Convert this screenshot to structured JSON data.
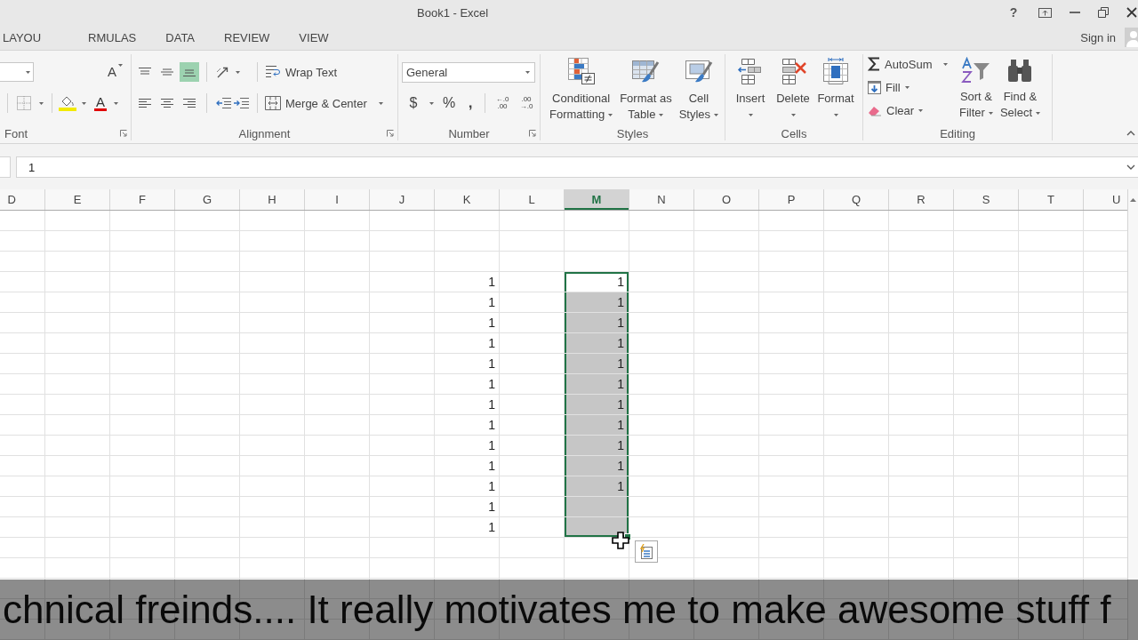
{
  "window": {
    "title": "Book1 - Excel",
    "help": "?",
    "sign_in": "Sign in"
  },
  "tabs": [
    {
      "label": "LAYOU",
      "selected": false
    },
    {
      "label": "RMULAS",
      "selected": false
    },
    {
      "label": "DATA",
      "selected": false
    },
    {
      "label": "REVIEW",
      "selected": false
    },
    {
      "label": "VIEW",
      "selected": false
    }
  ],
  "ribbon": {
    "font": {
      "label": "Font",
      "grow_font": "A",
      "font_color": "A"
    },
    "alignment": {
      "label": "Alignment",
      "vertical": [
        {
          "kind": "top",
          "selected": false
        },
        {
          "kind": "middle",
          "selected": false
        },
        {
          "kind": "bottom",
          "selected": true
        }
      ],
      "horizontal": [
        {
          "kind": "left",
          "selected": false
        },
        {
          "kind": "center",
          "selected": false
        },
        {
          "kind": "right",
          "selected": false
        }
      ],
      "wrap_text": "Wrap Text",
      "merge_center": "Merge & Center"
    },
    "number": {
      "label": "Number",
      "format": "General",
      "currency": "$",
      "percent": "%",
      "comma": ",",
      "decrease_decimal": [
        "←.0",
        ".00"
      ],
      "increase_decimal": [
        ".00",
        "→.0"
      ]
    },
    "styles": {
      "label": "Styles",
      "buttons": [
        {
          "kind": "conditional",
          "lines": [
            "Conditional",
            "Formatting"
          ]
        },
        {
          "kind": "table",
          "lines": [
            "Format as",
            "Table"
          ]
        },
        {
          "kind": "cell",
          "lines": [
            "Cell",
            "Styles"
          ]
        }
      ]
    },
    "cells": {
      "label": "Cells",
      "buttons": [
        {
          "kind": "insert",
          "label": "Insert"
        },
        {
          "kind": "delete",
          "label": "Delete"
        },
        {
          "kind": "format",
          "label": "Format"
        }
      ]
    },
    "editing": {
      "label": "Editing",
      "small": [
        {
          "kind": "autosum",
          "label": "AutoSum"
        },
        {
          "kind": "fill",
          "label": "Fill"
        },
        {
          "kind": "clear",
          "label": "Clear"
        }
      ],
      "big": [
        {
          "kind": "sort",
          "lines": [
            "Sort &",
            "Filter"
          ]
        },
        {
          "kind": "find",
          "lines": [
            "Find &",
            "Select"
          ]
        }
      ]
    }
  },
  "formula_bar": {
    "value": "1"
  },
  "sheet": {
    "columns": [
      {
        "label": "D",
        "selected": false
      },
      {
        "label": "E",
        "selected": false
      },
      {
        "label": "F",
        "selected": false
      },
      {
        "label": "G",
        "selected": false
      },
      {
        "label": "H",
        "selected": false
      },
      {
        "label": "I",
        "selected": false
      },
      {
        "label": "J",
        "selected": false
      },
      {
        "label": "K",
        "selected": false
      },
      {
        "label": "L",
        "selected": false
      },
      {
        "label": "M",
        "selected": true
      },
      {
        "label": "N",
        "selected": false
      },
      {
        "label": "O",
        "selected": false
      },
      {
        "label": "P",
        "selected": false
      },
      {
        "label": "Q",
        "selected": false
      },
      {
        "label": "R",
        "selected": false
      },
      {
        "label": "S",
        "selected": false
      },
      {
        "label": "T",
        "selected": false
      },
      {
        "label": "U",
        "selected": false
      }
    ],
    "rows": [
      {
        "column_k": "1",
        "column_m": "1",
        "selected": true,
        "active": true
      },
      {
        "column_k": "1",
        "column_m": "1",
        "selected": true,
        "active": false
      },
      {
        "column_k": "1",
        "column_m": "1",
        "selected": true,
        "active": false
      },
      {
        "column_k": "1",
        "column_m": "1",
        "selected": true,
        "active": false
      },
      {
        "column_k": "1",
        "column_m": "1",
        "selected": true,
        "active": false
      },
      {
        "column_k": "1",
        "column_m": "1",
        "selected": true,
        "active": false
      },
      {
        "column_k": "1",
        "column_m": "1",
        "selected": true,
        "active": false
      },
      {
        "column_k": "1",
        "column_m": "1",
        "selected": true,
        "active": false
      },
      {
        "column_k": "1",
        "column_m": "1",
        "selected": true,
        "active": false
      },
      {
        "column_k": "1",
        "column_m": "1",
        "selected": true,
        "active": false
      },
      {
        "column_k": "1",
        "column_m": "1",
        "selected": true,
        "active": false
      },
      {
        "column_k": "1",
        "selected": true,
        "active": false
      },
      {
        "column_k": "1",
        "selected": true,
        "active": false
      }
    ]
  },
  "caption": "chnical freinds.... It really motivates me to make awesome stuff f"
}
